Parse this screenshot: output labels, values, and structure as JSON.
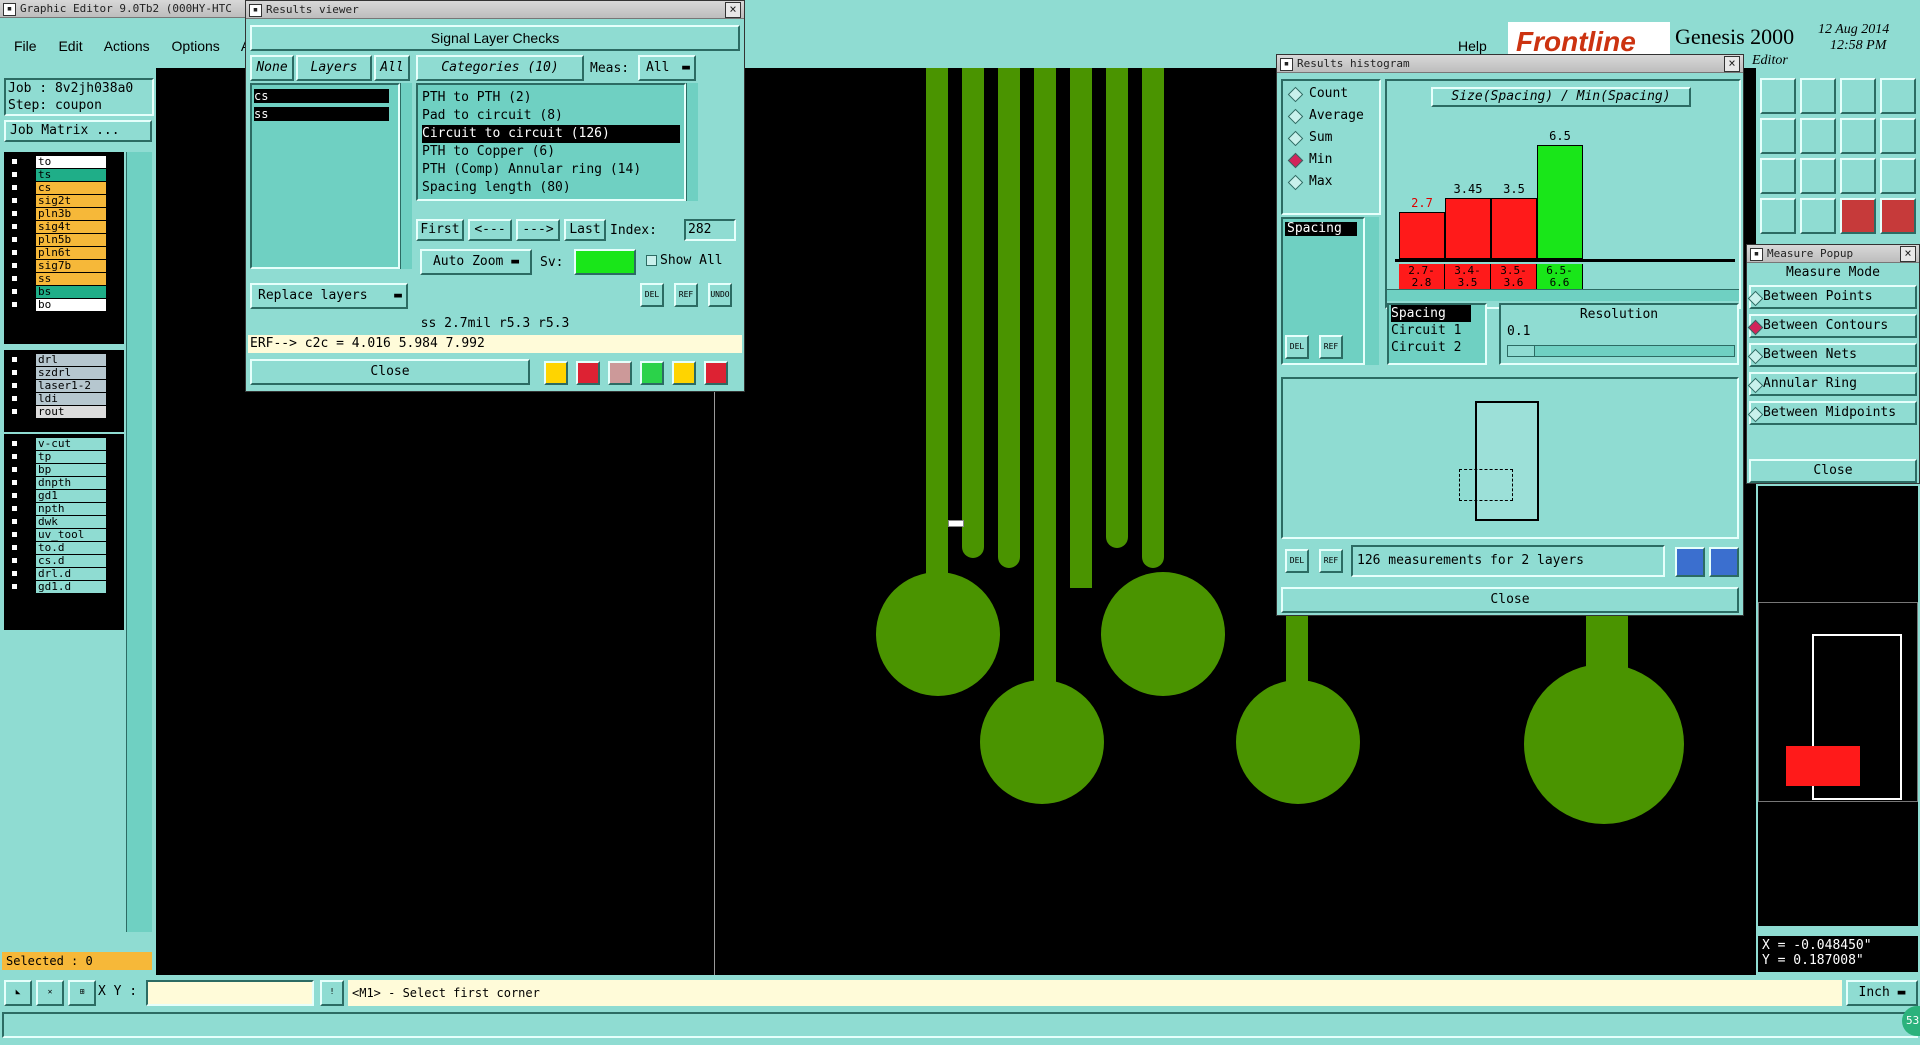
{
  "app": {
    "title": "Graphic Editor 9.0Tb2 (000HY-HTC",
    "menu": [
      "File",
      "Edit",
      "Actions",
      "Options",
      "An"
    ],
    "help": "Help",
    "brand": "Frontline",
    "product": "Genesis 2000",
    "date": "12 Aug 2014",
    "time": "12:58 PM",
    "mode": "Editor"
  },
  "job": {
    "job": "Job : 8v2jh038a0",
    "step": "Step: coupon",
    "matrix_button": "Job Matrix ..."
  },
  "layers": {
    "group1": [
      {
        "name": "to",
        "color": "#ffffff"
      },
      {
        "name": "ts",
        "color": "#1fae88"
      },
      {
        "name": "cs",
        "color": "#f6b839"
      },
      {
        "name": "sig2t",
        "color": "#f6b839"
      },
      {
        "name": "pln3b",
        "color": "#f6b839"
      },
      {
        "name": "sig4t",
        "color": "#f6b839"
      },
      {
        "name": "pln5b",
        "color": "#f6b839"
      },
      {
        "name": "pln6t",
        "color": "#f6b839"
      },
      {
        "name": "sig7b",
        "color": "#f6b839"
      },
      {
        "name": "ss",
        "color": "#f6b839"
      },
      {
        "name": "bs",
        "color": "#1fae88"
      },
      {
        "name": "bo",
        "color": "#ffffff"
      }
    ],
    "group2": [
      {
        "name": "drl",
        "color": "#b6c7cf"
      },
      {
        "name": "szdrl",
        "color": "#b6c7cf"
      },
      {
        "name": "laser1-2",
        "color": "#b6c7cf"
      },
      {
        "name": "ldi",
        "color": "#b6c7cf"
      },
      {
        "name": "rout",
        "color": "#dcdcdc"
      }
    ],
    "group3": [
      {
        "name": "v-cut",
        "color": "#8fdcd2"
      },
      {
        "name": "tp",
        "color": "#8fdcd2"
      },
      {
        "name": "bp",
        "color": "#8fdcd2"
      },
      {
        "name": "dnpth",
        "color": "#8fdcd2"
      },
      {
        "name": "gd1",
        "color": "#8fdcd2"
      },
      {
        "name": "npth",
        "color": "#8fdcd2"
      },
      {
        "name": "dwk",
        "color": "#8fdcd2"
      },
      {
        "name": "uv_tool",
        "color": "#8fdcd2"
      },
      {
        "name": "to.d",
        "color": "#8fdcd2"
      },
      {
        "name": "cs.d",
        "color": "#8fdcd2"
      },
      {
        "name": "drl.d",
        "color": "#8fdcd2"
      },
      {
        "name": "gd1.d",
        "color": "#8fdcd2"
      }
    ],
    "selected": "Selected : 0"
  },
  "results_viewer": {
    "title": "Results viewer",
    "heading": "Signal Layer Checks",
    "none": "None",
    "layers_label": "Layers",
    "all": "All",
    "layer_list": [
      "cs",
      "ss"
    ],
    "categories_label": "Categories (10)",
    "meas_label": "Meas:",
    "meas_value": "All",
    "categories": [
      "PTH to PTH (2)",
      "Pad to circuit (8)",
      "Circuit to circuit (126)",
      "PTH to Copper (6)",
      "PTH (Comp) Annular ring (14)",
      "Spacing length (80)"
    ],
    "selected_category": 2,
    "nav": [
      "First",
      "<---",
      "--->",
      "Last"
    ],
    "index_label": "Index:",
    "index_value": "282",
    "autozoom": "Auto Zoom",
    "sv": "Sv:",
    "show_all": "Show All",
    "replace_layers": "Replace layers",
    "small_buttons": [
      "DEL",
      "REF",
      "UNDO"
    ],
    "status": "ss 2.7mil   r5.3   r5.3",
    "erf": "ERF--> c2c = 4.016 5.984 7.992",
    "close": "Close"
  },
  "histogram": {
    "title": "Results histogram",
    "modes": [
      "Count",
      "Average",
      "Sum",
      "Min",
      "Max"
    ],
    "selected_mode": "Min",
    "chart_title": "Size(Spacing) / Min(Spacing)",
    "list_item": "Spacing",
    "resolution_label": "Resolution",
    "resolution_value": "0.1",
    "attr_list": [
      "Spacing",
      "Circuit 1",
      "Circuit 2"
    ],
    "measurements": "126 measurements for 2 layers",
    "close": "Close",
    "small_buttons": [
      "DEL",
      "REF"
    ]
  },
  "chart_data": {
    "type": "bar",
    "title": "Size(Spacing) / Min(Spacing)",
    "categories": [
      "2.7-2.8",
      "3.4-3.5",
      "3.5-3.6",
      "6.5-6.6"
    ],
    "values": [
      2.7,
      3.45,
      3.5,
      6.5
    ],
    "colors": [
      "#ff1a1a",
      "#ff1a1a",
      "#ff1a1a",
      "#19e619"
    ],
    "ylim": [
      0,
      6.5
    ]
  },
  "measure": {
    "title": "Measure Popup",
    "mode_label": "Measure Mode",
    "options": [
      "Between Points",
      "Between Contours",
      "Between Nets",
      "Annular Ring",
      "Between Midpoints"
    ],
    "selected": "Between Contours",
    "close": "Close"
  },
  "coords": {
    "x": "X = -0.048450\"",
    "y": "Y =  0.187008\""
  },
  "statusbar": {
    "xy_label": "X Y :",
    "prompt": "<M1> - Select first corner",
    "units": "Inch",
    "badge": "53"
  },
  "toolbar_icons": [
    "upload-icon",
    "download-icon",
    "home-icon",
    "grid-icon",
    "import-icon",
    "export-icon",
    "merge-icon",
    "flow-icon",
    "fit-icon",
    "center-icon",
    "ratio-icon",
    "help-icon",
    "settings-icon",
    "blank-icon",
    "drc-icon",
    "tools-icon"
  ]
}
